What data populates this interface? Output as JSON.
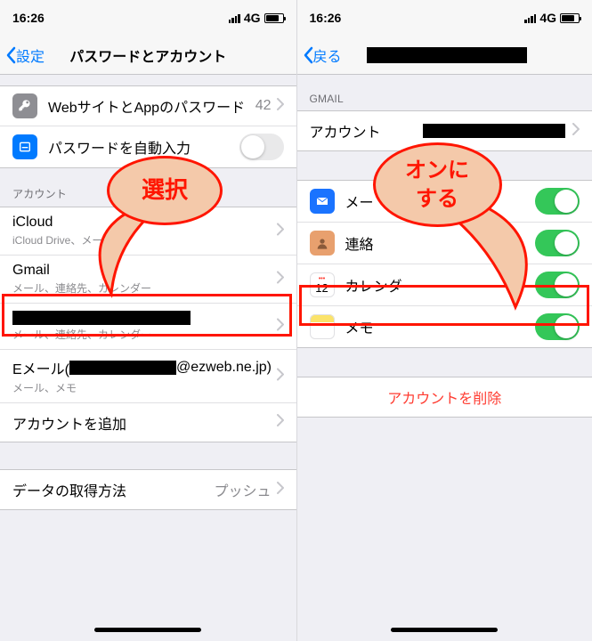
{
  "statusbar": {
    "time": "16:26",
    "network": "4G"
  },
  "left": {
    "nav": {
      "back": "設定",
      "title": "パスワードとアカウント"
    },
    "passwords": {
      "sites_label": "WebサイトとAppのパスワード",
      "sites_count": "42",
      "autofill_label": "パスワードを自動入力"
    },
    "section_accounts": "アカウント",
    "accounts": [
      {
        "title": "iCloud",
        "sub": "iCloud Drive、メール、"
      },
      {
        "title": "Gmail",
        "sub": "メール、連絡先、カレンダー"
      },
      {
        "title": "",
        "sub": "メール、連絡先、カレンダー",
        "redacted": true
      },
      {
        "title": "Eメール(",
        "title_tail": "@ezweb.ne.jp)",
        "sub": "メール、メモ"
      }
    ],
    "add_account": "アカウントを追加",
    "fetch_label": "データの取得方法",
    "fetch_value": "プッシュ",
    "callout_text": "選択"
  },
  "right": {
    "nav": {
      "back": "戻る"
    },
    "section_gmail": "GMAIL",
    "account_label": "アカウント",
    "services": {
      "mail": "メー",
      "contacts": "連絡",
      "calendar": "カレンダー",
      "notes": "メモ"
    },
    "delete": "アカウントを削除",
    "callout_text": "オンに\nする"
  }
}
